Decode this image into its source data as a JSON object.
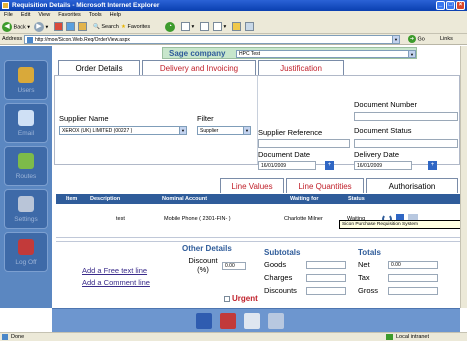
{
  "window": {
    "title": "Requisition Details - Microsoft Internet Explorer"
  },
  "menu": [
    "File",
    "Edit",
    "View",
    "Favorites",
    "Tools",
    "Help"
  ],
  "toolbar": {
    "back": "Back",
    "search": "Search",
    "favorites": "Favorites"
  },
  "address": {
    "label": "Address",
    "url": "http://moe/Sicon.Web.Req/OrderView.aspx",
    "go": "Go",
    "links": "Links"
  },
  "nav": [
    {
      "label": "Users",
      "icon": "users-icon",
      "color": "#d9a93a"
    },
    {
      "label": "Email",
      "icon": "email-icon",
      "color": "#cfe0f5"
    },
    {
      "label": "Routes",
      "icon": "routes-icon",
      "color": "#7dbb4a"
    },
    {
      "label": "Settings",
      "icon": "settings-icon",
      "color": "#b9c5d8"
    },
    {
      "label": "Log Off",
      "icon": "logoff-icon",
      "color": "#c23a3a"
    }
  ],
  "company": {
    "label": "Sage company",
    "value": "HPC Test"
  },
  "tabs": {
    "order_details": "Order Details",
    "delivery": "Delivery and Invoicing",
    "justification": "Justification"
  },
  "header": {
    "supplier_name_label": "Supplier Name",
    "supplier_value": "XEROX (UK) LIMITED (00227 )",
    "filter_label": "Filter",
    "filter_value": "Supplier",
    "supplier_ref_label": "Supplier Reference",
    "supplier_ref_value": "",
    "doc_number_label": "Document Number",
    "doc_number_value": "",
    "doc_status_label": "Document Status",
    "doc_status_value": "",
    "doc_date_label": "Document Date",
    "doc_date_value": "16/01/2009",
    "delivery_date_label": "Delivery Date",
    "delivery_date_value": "16/01/2009"
  },
  "line_tabs": {
    "values": "Line Values",
    "quantities": "Line Quantities",
    "authorisation": "Authorisation"
  },
  "line_table": {
    "columns": [
      "Item",
      "Description",
      "Nominal Account",
      "Waiting for",
      "Status"
    ],
    "rows": [
      {
        "item": "",
        "description": "test",
        "nominal": "Mobile Phone ( 2301-FIN- )",
        "waiting_for": "Charlotte Milner",
        "status": "Waiting"
      }
    ]
  },
  "tooltip": "Sicon Purchase Requisition System",
  "footer": {
    "add_free_text": "Add a Free text line",
    "add_comment": "Add a Comment line",
    "other_details_label": "Other Details",
    "discount_label": "Discount (%)",
    "discount_value": "0.00",
    "urgent_label": "Urgent",
    "subtotals_label": "Subtotals",
    "goods_label": "Goods",
    "goods_value": "",
    "charges_label": "Charges",
    "charges_value": "",
    "discounts_label": "Discounts",
    "discounts_value": "",
    "totals_label": "Totals",
    "net_label": "Net",
    "net_value": "0.00",
    "tax_label": "Tax",
    "tax_value": "",
    "gross_label": "Gross",
    "gross_value": ""
  },
  "status": {
    "left": "Done",
    "right": "Local intranet"
  }
}
